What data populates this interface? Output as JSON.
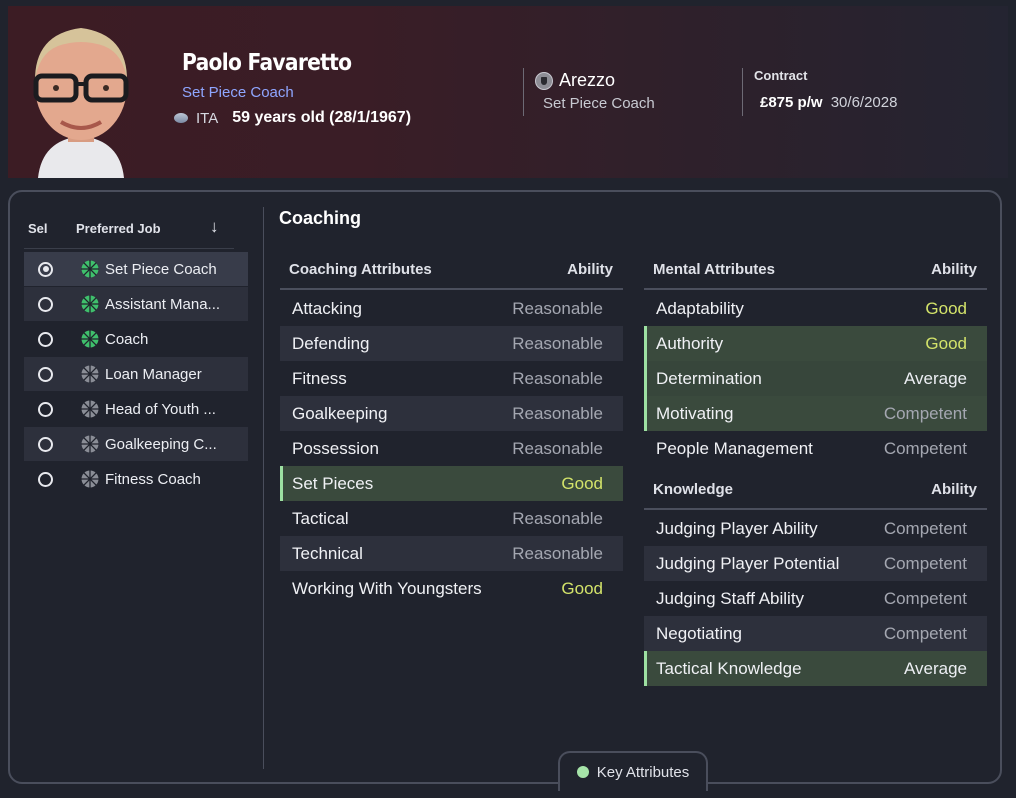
{
  "header": {
    "name": "Paolo Favaretto",
    "role": "Set Piece Coach",
    "nationality": "ITA",
    "age": "59 years old (28/1/1967)",
    "club": "Arezzo",
    "club_role": "Set Piece Coach",
    "contract_label": "Contract",
    "wage": "£875 p/w",
    "expiry": "30/6/2028"
  },
  "jobs": {
    "col_sel": "Sel",
    "col_job": "Preferred Job",
    "sort_icon": "↓",
    "items": [
      {
        "label": "Set Piece Coach",
        "selected": true,
        "icon": "green-pie-icon"
      },
      {
        "label": "Assistant Mana...",
        "selected": false,
        "icon": "green-pie-icon"
      },
      {
        "label": "Coach",
        "selected": false,
        "icon": "green-pie-icon"
      },
      {
        "label": "Loan Manager",
        "selected": false,
        "icon": "grey-pie-icon"
      },
      {
        "label": "Head of Youth ...",
        "selected": false,
        "icon": "grey-pie-icon"
      },
      {
        "label": "Goalkeeping C...",
        "selected": false,
        "icon": "grey-pie-icon"
      },
      {
        "label": "Fitness Coach",
        "selected": false,
        "icon": "grey-pie-icon"
      }
    ]
  },
  "section_title": "Coaching",
  "coaching": {
    "title": "Coaching Attributes",
    "ability_label": "Ability",
    "rows": [
      {
        "name": "Attacking",
        "value": "Reasonable"
      },
      {
        "name": "Defending",
        "value": "Reasonable"
      },
      {
        "name": "Fitness",
        "value": "Reasonable"
      },
      {
        "name": "Goalkeeping",
        "value": "Reasonable"
      },
      {
        "name": "Possession",
        "value": "Reasonable"
      },
      {
        "name": "Set Pieces",
        "value": "Good"
      },
      {
        "name": "Tactical",
        "value": "Reasonable"
      },
      {
        "name": "Technical",
        "value": "Reasonable"
      },
      {
        "name": "Working With Youngsters",
        "value": "Good"
      }
    ]
  },
  "mental": {
    "title": "Mental Attributes",
    "ability_label": "Ability",
    "rows": [
      {
        "name": "Adaptability",
        "value": "Good"
      },
      {
        "name": "Authority",
        "value": "Good"
      },
      {
        "name": "Determination",
        "value": "Average"
      },
      {
        "name": "Motivating",
        "value": "Competent"
      },
      {
        "name": "People Management",
        "value": "Competent"
      }
    ]
  },
  "knowledge": {
    "title": "Knowledge",
    "ability_label": "Ability",
    "rows": [
      {
        "name": "Judging Player Ability",
        "value": "Competent"
      },
      {
        "name": "Judging Player Potential",
        "value": "Competent"
      },
      {
        "name": "Judging Staff Ability",
        "value": "Competent"
      },
      {
        "name": "Negotiating",
        "value": "Competent"
      },
      {
        "name": "Tactical Knowledge",
        "value": "Average"
      }
    ]
  },
  "key_tab": "Key Attributes",
  "colors": {
    "good": "#d3e36a",
    "muted": "#a4a7b1",
    "highlight": "#3a4a3d",
    "accent_green": "#9de0a2",
    "link": "#8fa6ff"
  }
}
